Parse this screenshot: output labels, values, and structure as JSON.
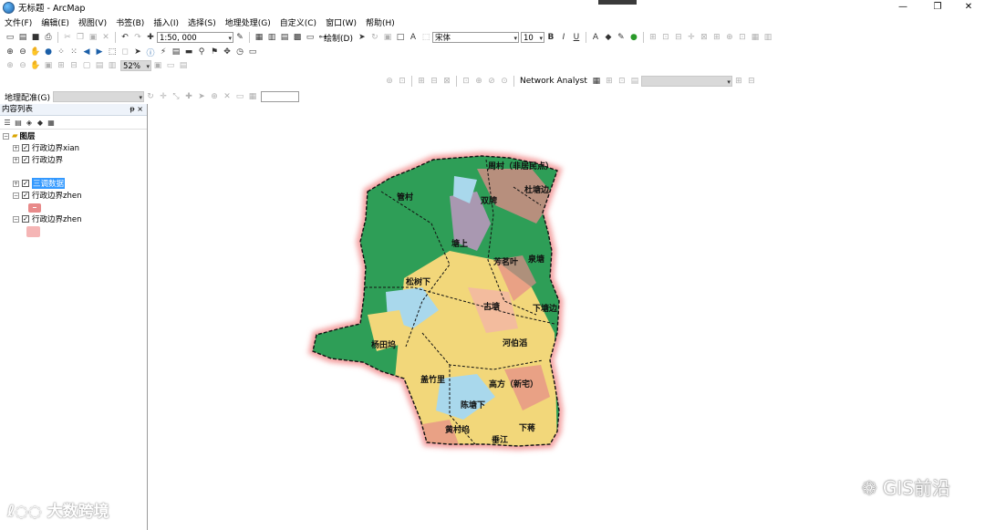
{
  "window": {
    "title": "无标题 - ArcMap",
    "controls": [
      "—",
      "❐",
      "✕"
    ]
  },
  "menu": [
    "文件(F)",
    "编辑(E)",
    "视图(V)",
    "书签(B)",
    "插入(I)",
    "选择(S)",
    "地理处理(G)",
    "自定义(C)",
    "窗口(W)",
    "帮助(H)"
  ],
  "standard_toolbar": {
    "scale": "1:50, 000"
  },
  "draw_toolbar": {
    "label": "绘制(D)",
    "font": "宋体",
    "font_size": "10"
  },
  "tools_toolbar": {
    "zoom": "52%"
  },
  "network_analyst": {
    "label": "Network Analyst"
  },
  "georef_toolbar": {
    "label": "地理配准(G)"
  },
  "toc": {
    "title": "内容列表",
    "pin": "ᵽ ×",
    "root": "图层",
    "layers": [
      {
        "name": "行政边界xian",
        "expand": "⊞",
        "checked": "☑"
      },
      {
        "name": "行政边界",
        "expand": "⊞",
        "checked": "☑"
      },
      {
        "name": "三调数据",
        "expand": "⊞",
        "checked": "☑"
      },
      {
        "name": "行政边界zhen",
        "expand": "⊟",
        "checked": "☑"
      },
      {
        "name": "行政边界zhen",
        "expand": "⊟",
        "checked": "☑"
      }
    ],
    "swatch_colors": [
      "#e88a8a",
      "#f5b5b5"
    ]
  },
  "map": {
    "labels": [
      {
        "text": "周村（非居民点）"
      },
      {
        "text": "管村"
      },
      {
        "text": "双牌"
      },
      {
        "text": "杜塘边"
      },
      {
        "text": "塘上"
      },
      {
        "text": "芳茗叶"
      },
      {
        "text": "泉塘"
      },
      {
        "text": "松树下"
      },
      {
        "text": "古塘"
      },
      {
        "text": "下塘边"
      },
      {
        "text": "杨田坞"
      },
      {
        "text": "河伯滔"
      },
      {
        "text": "盖竹里"
      },
      {
        "text": "高方（新宅）"
      },
      {
        "text": "陈塘下"
      },
      {
        "text": "黄村坞"
      },
      {
        "text": "下蒋"
      },
      {
        "text": "垂江"
      }
    ],
    "colors": {
      "forest": "#2e9e57",
      "water": "#a9d8ec",
      "farmland": "#f2d77a",
      "urban": "#e58a8a",
      "boundary_halo": "#f4a0a0"
    }
  },
  "watermarks": {
    "left": "大数跨境",
    "right": "GIS前沿"
  }
}
